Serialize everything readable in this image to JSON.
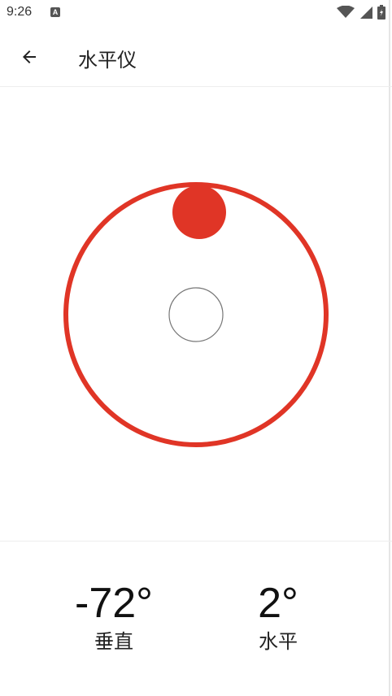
{
  "status_bar": {
    "time": "9:26",
    "notification_icon": "A",
    "icons": [
      "wifi-icon",
      "signal-icon",
      "battery-charging-icon"
    ]
  },
  "app_bar": {
    "back_icon": "arrow-left-icon",
    "title": "水平仪"
  },
  "level": {
    "vertical_angle": -72,
    "horizontal_angle": 2,
    "colors": {
      "accent": "#e03526",
      "target_ring": "#777777"
    }
  },
  "readouts": {
    "vertical": {
      "value": "-72°",
      "label": "垂直"
    },
    "horizontal": {
      "value": "2°",
      "label": "水平"
    }
  }
}
